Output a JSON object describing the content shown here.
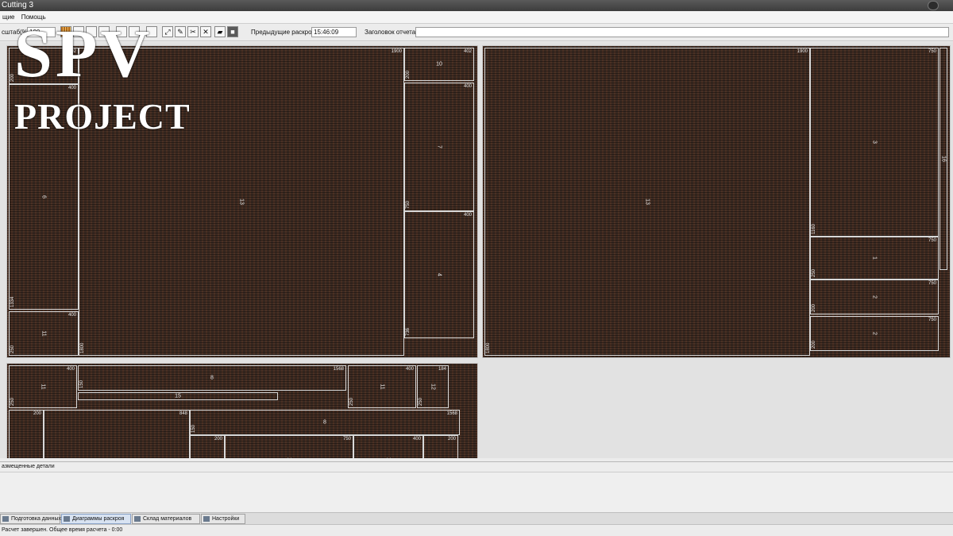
{
  "window": {
    "title": "Cutting 3"
  },
  "menu": {
    "items": [
      "щие",
      "Помощь"
    ]
  },
  "toolbar": {
    "scale_label": "сштаб(%)",
    "scale_value": "100",
    "previous_cuts_label": "Предыдущие раскрои",
    "previous_cuts_value": "15:46:09",
    "report_title_label": "Заголовок отчета",
    "report_title_value": ""
  },
  "sheets": [
    {
      "parts": [
        {
          "w": "402",
          "h": "200",
          "n": ""
        },
        {
          "w": "400",
          "h": "1334",
          "n": "6"
        },
        {
          "w": "400",
          "h": "250",
          "n": "11"
        },
        {
          "w": "1900",
          "h": "1800",
          "n": "13"
        },
        {
          "w": "402",
          "h": "200",
          "n": "10"
        },
        {
          "w": "400",
          "h": "750",
          "n": "7"
        },
        {
          "w": "400",
          "h": "736",
          "n": "4"
        }
      ]
    },
    {
      "parts": [
        {
          "w": "1900",
          "h": "1800",
          "n": "13"
        },
        {
          "w": "750",
          "h": "1160",
          "n": "3"
        },
        {
          "w": "",
          "h": "",
          "n": "16"
        },
        {
          "w": "750",
          "h": "250",
          "n": "1"
        },
        {
          "w": "750",
          "h": "200",
          "n": "2"
        },
        {
          "w": "750",
          "h": "200",
          "n": "2"
        }
      ]
    },
    {
      "parts": [
        {
          "w": "400",
          "h": "250",
          "n": "11"
        },
        {
          "w": "1568",
          "h": "150",
          "n": "8"
        },
        {
          "w": "",
          "h": "",
          "n": "15"
        },
        {
          "w": "400",
          "h": "250",
          "n": "11"
        },
        {
          "w": "184",
          "h": "250",
          "n": "12"
        },
        {
          "w": "200",
          "h": "",
          "n": ""
        },
        {
          "w": "848",
          "h": "",
          "n": ""
        },
        {
          "w": "1568",
          "h": "150",
          "n": "8"
        },
        {
          "w": "200",
          "h": "",
          "n": ""
        },
        {
          "w": "750",
          "h": "",
          "n": "1"
        },
        {
          "w": "400",
          "h": "",
          "n": "1"
        },
        {
          "w": "200",
          "h": "",
          "n": ""
        }
      ]
    }
  ],
  "unplaced": {
    "label": "азмещенные детали"
  },
  "tabs": [
    {
      "label": "Подготовка данных",
      "active": false
    },
    {
      "label": "Диаграммы раскроя",
      "active": true
    },
    {
      "label": "Склад материалов",
      "active": false
    },
    {
      "label": "Настройки",
      "active": false
    }
  ],
  "status": {
    "text": "Расчет завершен. Общее время расчета - 0:00"
  },
  "watermark": {
    "line1": "SPV",
    "line2": "PROJECT"
  },
  "colors": {
    "board": "#3a2a22",
    "part_border": "#d8d8d8",
    "active_tab": "#d8e3f2"
  }
}
